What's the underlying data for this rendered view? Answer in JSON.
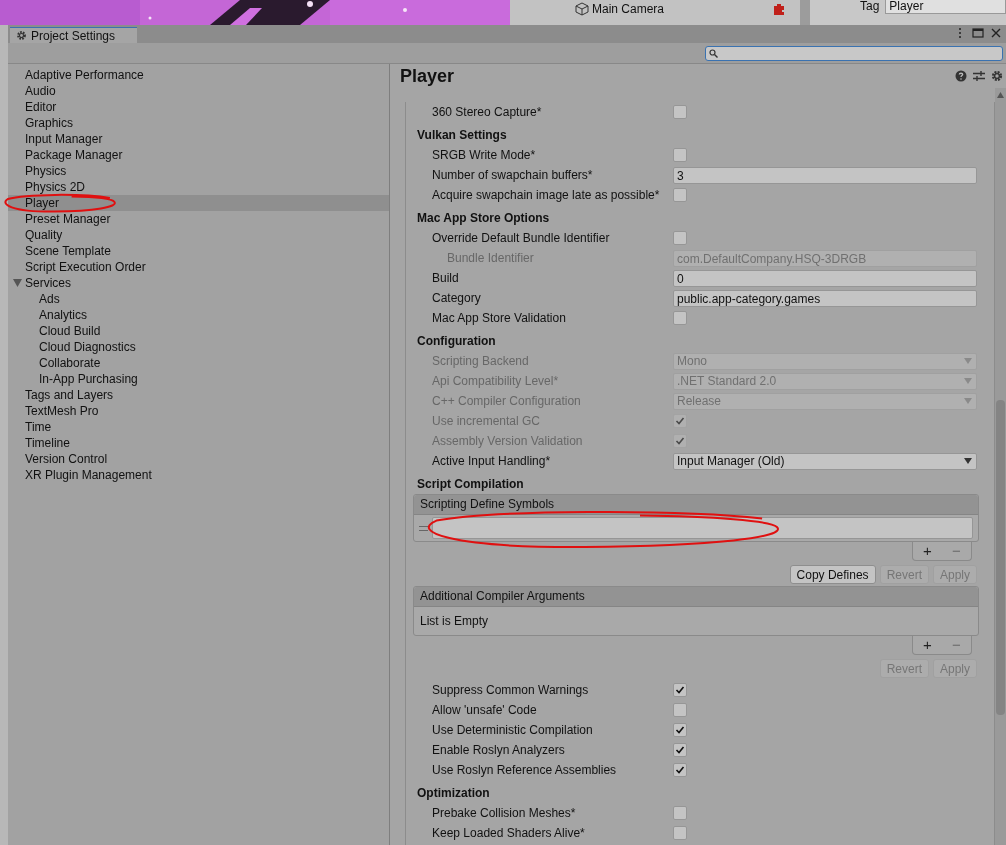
{
  "backdrop": {
    "hierarchy_item": "Main Camera",
    "tag_label": "Tag",
    "tag_value": "Player"
  },
  "window": {
    "title": "Project Settings"
  },
  "sidebar": {
    "items": [
      {
        "label": "Adaptive Performance",
        "selected": false
      },
      {
        "label": "Audio",
        "selected": false
      },
      {
        "label": "Editor",
        "selected": false
      },
      {
        "label": "Graphics",
        "selected": false
      },
      {
        "label": "Input Manager",
        "selected": false
      },
      {
        "label": "Package Manager",
        "selected": false
      },
      {
        "label": "Physics",
        "selected": false
      },
      {
        "label": "Physics 2D",
        "selected": false
      },
      {
        "label": "Player",
        "selected": true,
        "circled": true
      },
      {
        "label": "Preset Manager",
        "selected": false
      },
      {
        "label": "Quality",
        "selected": false
      },
      {
        "label": "Scene Template",
        "selected": false
      },
      {
        "label": "Script Execution Order",
        "selected": false
      },
      {
        "label": "Services",
        "selected": false,
        "expanded": true,
        "children": [
          {
            "label": "Ads",
            "selected": false
          },
          {
            "label": "Analytics",
            "selected": false
          },
          {
            "label": "Cloud Build",
            "selected": false
          },
          {
            "label": "Cloud Diagnostics",
            "selected": false
          },
          {
            "label": "Collaborate",
            "selected": false
          },
          {
            "label": "In-App Purchasing",
            "selected": false
          }
        ]
      },
      {
        "label": "Tags and Layers",
        "selected": false
      },
      {
        "label": "TextMesh Pro",
        "selected": false
      },
      {
        "label": "Time",
        "selected": false
      },
      {
        "label": "Timeline",
        "selected": false
      },
      {
        "label": "Version Control",
        "selected": false
      },
      {
        "label": "XR Plugin Management",
        "selected": false
      }
    ]
  },
  "panel": {
    "title": "Player",
    "settings": [
      {
        "kind": "checkbox",
        "label": "360 Stereo Capture*",
        "checked": false,
        "disabled": false
      },
      {
        "kind": "heading",
        "label": "Vulkan Settings"
      },
      {
        "kind": "checkbox",
        "label": "SRGB Write Mode*",
        "checked": false,
        "disabled": false
      },
      {
        "kind": "field",
        "label": "Number of swapchain buffers*",
        "value": "3",
        "disabled": false
      },
      {
        "kind": "checkbox",
        "label": "Acquire swapchain image late as possible*",
        "checked": false,
        "disabled": false
      },
      {
        "kind": "heading",
        "label": "Mac App Store Options"
      },
      {
        "kind": "checkbox",
        "label": "Override Default Bundle Identifier",
        "checked": false,
        "disabled": false,
        "children": [
          {
            "kind": "field",
            "label": "Bundle Identifier",
            "value": "com.DefaultCompany.HSQ-3DRGB",
            "disabled": true
          }
        ]
      },
      {
        "kind": "field",
        "label": "Build",
        "value": "0",
        "disabled": false
      },
      {
        "kind": "field",
        "label": "Category",
        "value": "public.app-category.games",
        "disabled": false
      },
      {
        "kind": "checkbox",
        "label": "Mac App Store Validation",
        "checked": false,
        "disabled": false
      },
      {
        "kind": "heading",
        "label": "Configuration"
      },
      {
        "kind": "dropdown",
        "label": "Scripting Backend",
        "value": "Mono",
        "disabled": true
      },
      {
        "kind": "dropdown",
        "label": "Api Compatibility Level*",
        "value": ".NET Standard 2.0",
        "disabled": true
      },
      {
        "kind": "dropdown",
        "label": "C++ Compiler Configuration",
        "value": "Release",
        "disabled": true
      },
      {
        "kind": "checkbox",
        "label": "Use incremental GC",
        "checked": true,
        "disabled": true
      },
      {
        "kind": "checkbox",
        "label": "Assembly Version Validation",
        "checked": true,
        "disabled": true
      },
      {
        "kind": "dropdown",
        "label": "Active Input Handling*",
        "value": "Input Manager (Old)",
        "disabled": false
      },
      {
        "kind": "heading",
        "label": "Script Compilation"
      },
      {
        "kind": "list",
        "title": "Scripting Define Symbols",
        "entries": [
          {
            "kind": "text-entry",
            "circled": true
          }
        ],
        "add": "+",
        "remove": "−"
      },
      {
        "kind": "buttons",
        "buttons": [
          {
            "label": "Copy Defines",
            "disabled": false
          },
          {
            "label": "Revert",
            "disabled": true
          },
          {
            "label": "Apply",
            "disabled": true
          }
        ]
      },
      {
        "kind": "list",
        "title": "Additional Compiler Arguments",
        "empty_text": "List is Empty",
        "add": "+",
        "remove": "−"
      },
      {
        "kind": "buttons",
        "buttons": [
          {
            "label": "Revert",
            "disabled": true
          },
          {
            "label": "Apply",
            "disabled": true
          }
        ]
      },
      {
        "kind": "checkbox",
        "label": "Suppress Common Warnings",
        "checked": true,
        "disabled": false
      },
      {
        "kind": "checkbox",
        "label": "Allow 'unsafe' Code",
        "checked": false,
        "disabled": false
      },
      {
        "kind": "checkbox",
        "label": "Use Deterministic Compilation",
        "checked": true,
        "disabled": false
      },
      {
        "kind": "checkbox",
        "label": "Enable Roslyn Analyzers",
        "checked": true,
        "disabled": false
      },
      {
        "kind": "checkbox",
        "label": "Use Roslyn Reference Assemblies",
        "checked": true,
        "disabled": false
      },
      {
        "kind": "heading",
        "label": "Optimization"
      },
      {
        "kind": "checkbox",
        "label": "Prebake Collision Meshes*",
        "checked": false,
        "disabled": false
      },
      {
        "kind": "checkbox",
        "label": "Keep Loaded Shaders Alive*",
        "checked": false,
        "disabled": false
      }
    ]
  }
}
